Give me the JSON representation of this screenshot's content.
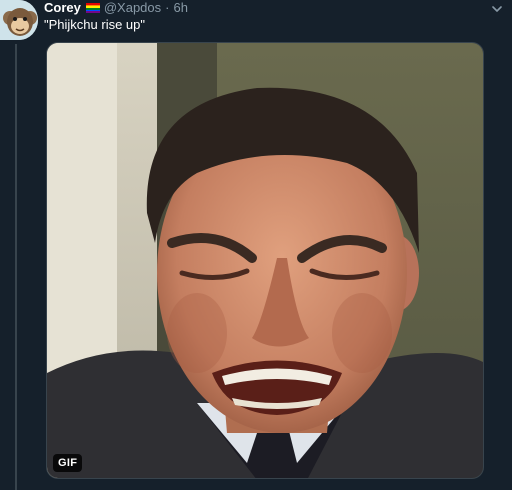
{
  "tweet": {
    "author": {
      "name": "Corey",
      "handle": "@Xapdos",
      "avatar_icon": "monkey-avatar-icon"
    },
    "separator": "·",
    "time": "6h",
    "text": "\"Phijkchu rise up\"",
    "media": {
      "type": "gif",
      "badge": "GIF",
      "description_icon": "cringing-man-gif"
    },
    "flag_colors": [
      "#e40303",
      "#ff8c00",
      "#ffed00",
      "#008026",
      "#004dff",
      "#750787"
    ]
  },
  "colors": {
    "background": "#15202b",
    "secondary_text": "#8899a6",
    "border": "#38444d"
  }
}
